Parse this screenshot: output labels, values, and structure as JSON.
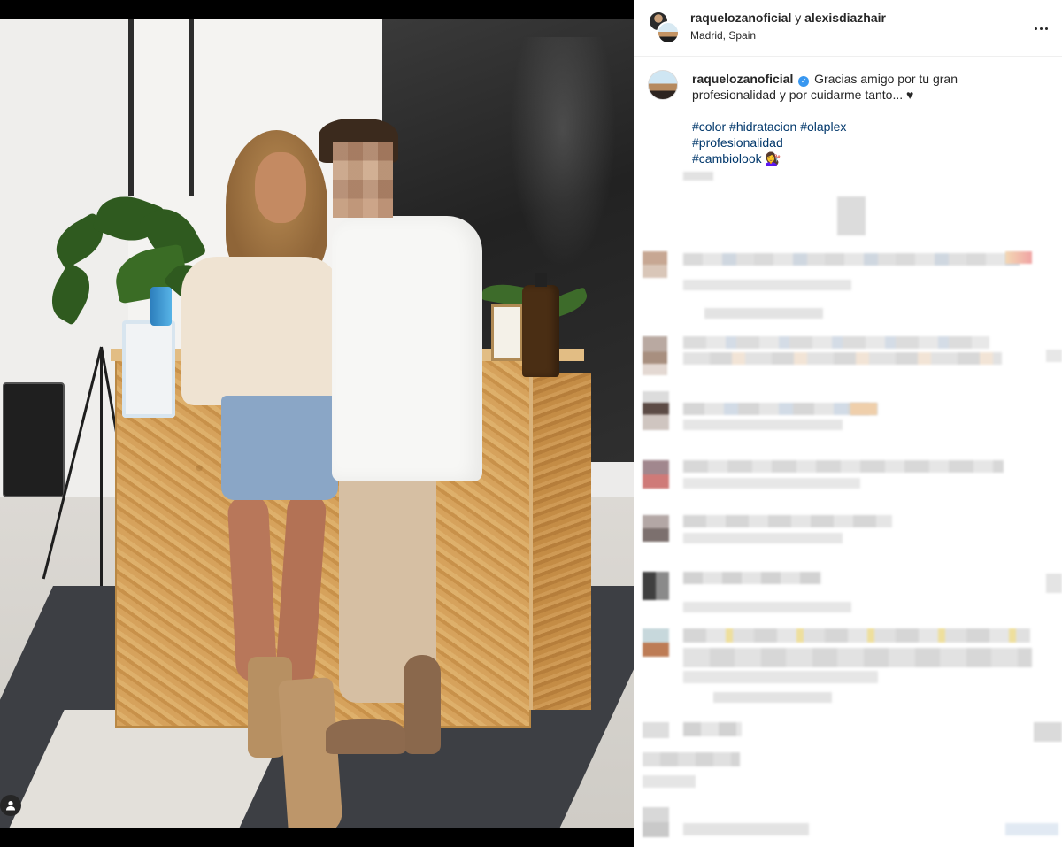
{
  "header": {
    "user1": "raquelozanoficial",
    "connector": "y",
    "user2": "alexisdiazhair",
    "location": "Madrid, Spain"
  },
  "caption": {
    "username": "raquelozanoficial",
    "text": "Gracias amigo por tu gran profesionalidad y por cuidarme tanto... ♥",
    "hashtags": [
      "#color",
      "#hidratacion",
      "#olaplex",
      "#profesionalidad",
      "#cambiolook"
    ],
    "emoji": "💇‍♀️"
  },
  "colors": {
    "link": "#00376b",
    "verified": "#3897f0"
  },
  "icons": {
    "more": "more-horizontal-icon",
    "user_tag": "user-tag-icon",
    "verified": "verified-badge-icon"
  }
}
